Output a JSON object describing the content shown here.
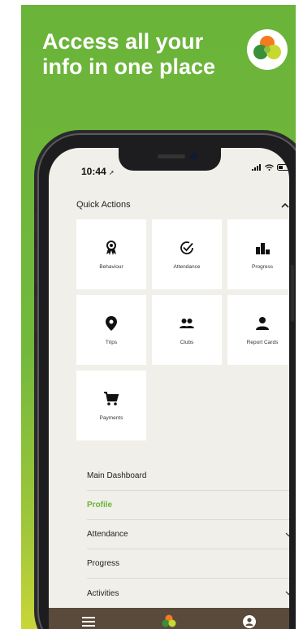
{
  "headline": "Access all your info in one place",
  "colors": {
    "brand_green": "#6ab43a",
    "bar_brown": "#5a4a3c",
    "screen_bg": "#f1efe9"
  },
  "status": {
    "time": "10:44"
  },
  "quick_actions": {
    "title": "Quick Actions",
    "tiles": [
      {
        "label": "Behaviour",
        "icon": "award-icon"
      },
      {
        "label": "Attendance",
        "icon": "check-circle-icon"
      },
      {
        "label": "Progress",
        "icon": "podium-icon"
      },
      {
        "label": "Trips",
        "icon": "location-pin-icon"
      },
      {
        "label": "Clubs",
        "icon": "group-icon"
      },
      {
        "label": "Report Cards",
        "icon": "person-icon"
      },
      {
        "label": "Payments",
        "icon": "cart-icon"
      }
    ]
  },
  "menu": [
    {
      "label": "Main Dashboard"
    },
    {
      "label": "Profile",
      "active": true
    },
    {
      "label": "Attendance",
      "expandable": true
    },
    {
      "label": "Progress"
    },
    {
      "label": "Activities",
      "expandable": true
    }
  ],
  "bottom_nav": [
    "hamburger-menu-icon",
    "logo-icon",
    "account-icon"
  ]
}
